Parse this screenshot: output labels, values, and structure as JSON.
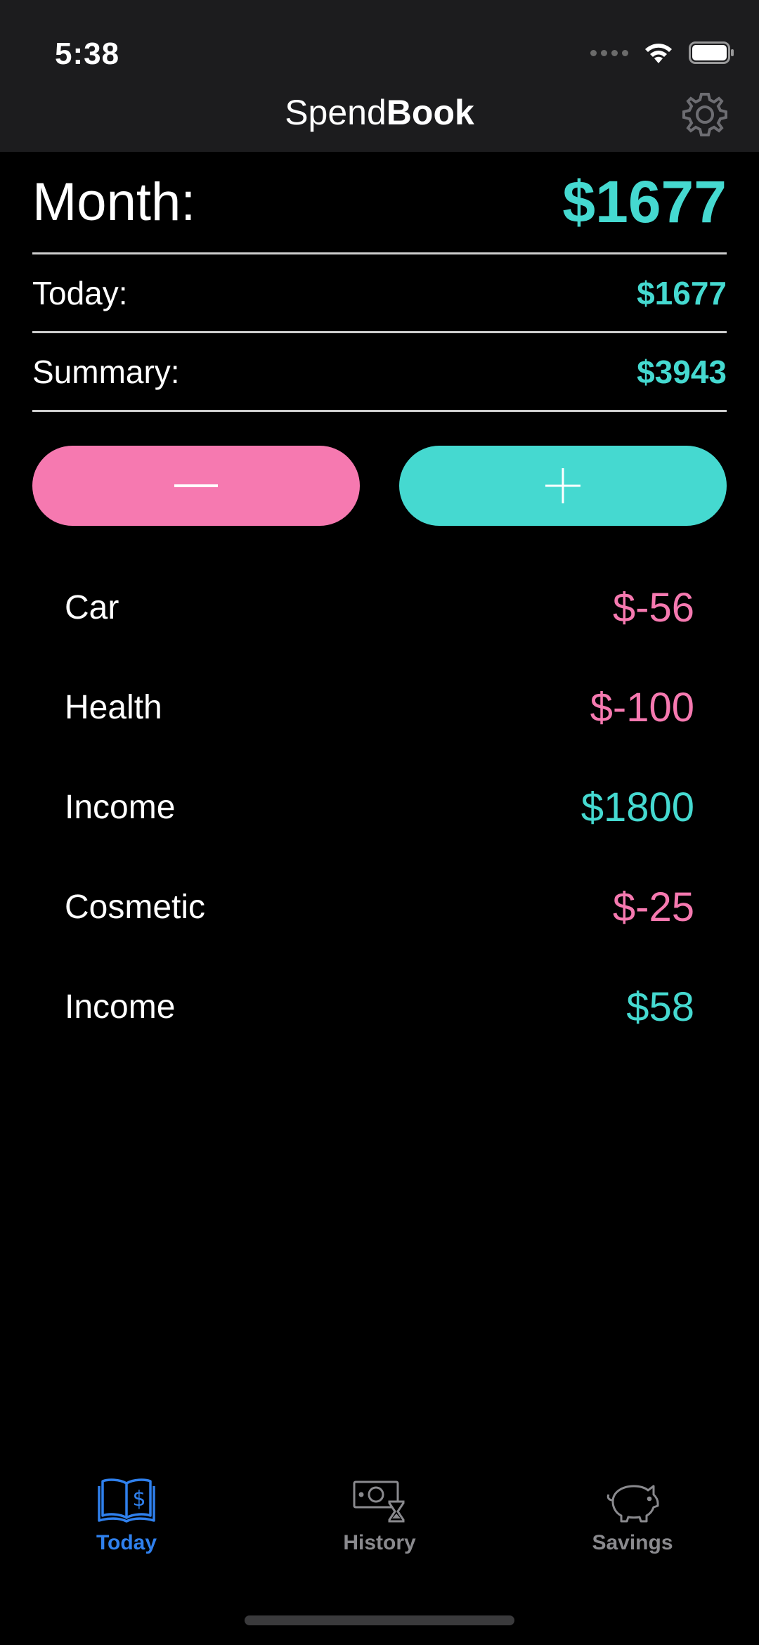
{
  "status_bar": {
    "time": "5:38"
  },
  "nav": {
    "title_light": "Spend",
    "title_bold": "Book"
  },
  "summary": {
    "month_label": "Month:",
    "month_value": "$1677",
    "today_label": "Today:",
    "today_value": "$1677",
    "summary_label": "Summary:",
    "summary_value": "$3943"
  },
  "transactions": [
    {
      "category": "Car",
      "amount": "$-56",
      "type": "expense"
    },
    {
      "category": "Health",
      "amount": "$-100",
      "type": "expense"
    },
    {
      "category": "Income",
      "amount": "$1800",
      "type": "income"
    },
    {
      "category": "Cosmetic",
      "amount": "$-25",
      "type": "expense"
    },
    {
      "category": "Income",
      "amount": "$58",
      "type": "income"
    }
  ],
  "tabs": [
    {
      "label": "Today",
      "icon": "book-dollar-icon",
      "active": true
    },
    {
      "label": "History",
      "icon": "cash-hourglass-icon",
      "active": false
    },
    {
      "label": "Savings",
      "icon": "piggy-bank-icon",
      "active": false
    }
  ],
  "colors": {
    "accent_teal": "#45d9d0",
    "accent_pink": "#f679b0",
    "tab_active": "#2f80ed",
    "tab_inactive": "#8a8a8e",
    "bar_bg": "#1c1c1e"
  }
}
